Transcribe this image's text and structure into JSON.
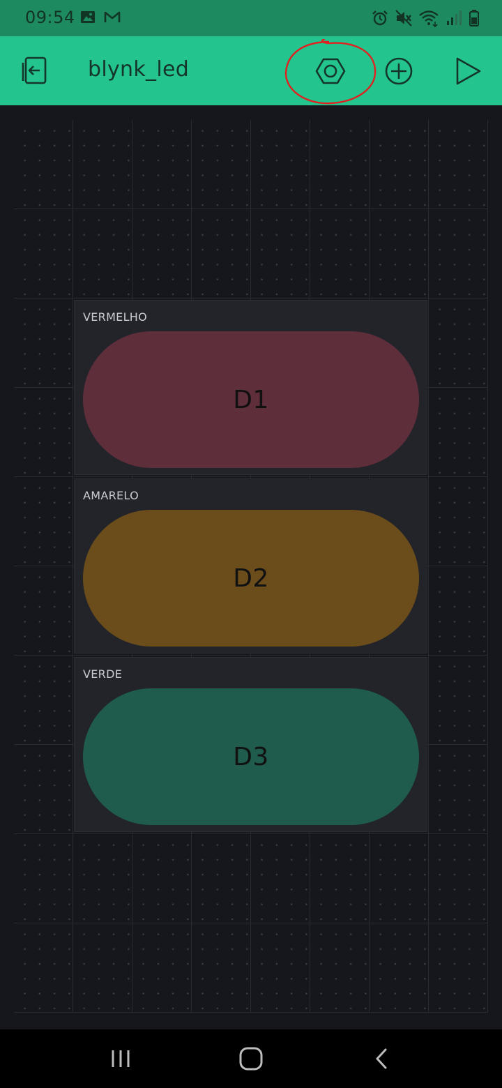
{
  "status_bar": {
    "time": "09:54",
    "left_icons": [
      "image-icon",
      "mail-icon"
    ],
    "right_icons": [
      "alarm-icon",
      "mute-icon",
      "wifi-icon",
      "signal-icon",
      "battery-icon"
    ]
  },
  "app_bar": {
    "title": "blynk_led",
    "icons": [
      "exit-project-icon",
      "settings-hex-icon",
      "add-widget-icon",
      "play-icon"
    ]
  },
  "widgets": [
    {
      "label": "VERMELHO",
      "button_text": "D1",
      "color": "#5e2e3b"
    },
    {
      "label": "AMARELO",
      "button_text": "D2",
      "color": "#6a4d1b"
    },
    {
      "label": "VERDE",
      "button_text": "D3",
      "color": "#1f5c4d"
    }
  ],
  "nav_bar": {
    "icons": [
      "recent-apps-icon",
      "home-icon",
      "back-icon"
    ]
  },
  "colors": {
    "accent": "#23c48e",
    "status_bar": "#1e8a5f",
    "annotation": "#e0211f",
    "background": "#16171c"
  }
}
